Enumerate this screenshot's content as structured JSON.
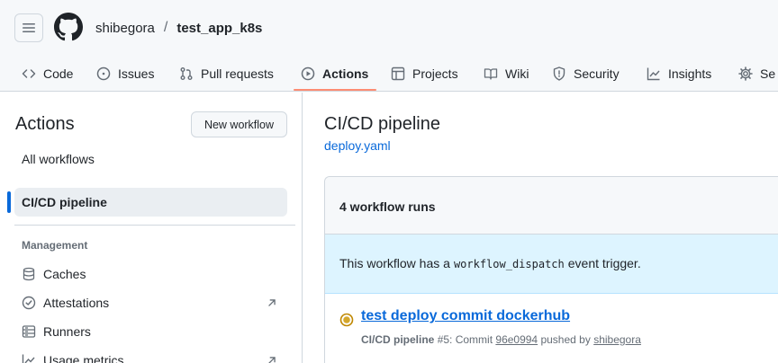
{
  "header": {
    "owner": "shibegora",
    "separator": "/",
    "repo": "test_app_k8s",
    "menu_icon": "hamburger-icon",
    "logo_icon": "github-mark-icon"
  },
  "tabs": [
    {
      "label": "Code",
      "icon": "code-icon"
    },
    {
      "label": "Issues",
      "icon": "issue-opened-icon"
    },
    {
      "label": "Pull requests",
      "icon": "git-pull-request-icon"
    },
    {
      "label": "Actions",
      "icon": "play-icon",
      "active": true
    },
    {
      "label": "Projects",
      "icon": "table-icon"
    },
    {
      "label": "Wiki",
      "icon": "book-icon"
    },
    {
      "label": "Security",
      "icon": "shield-icon"
    },
    {
      "label": "Insights",
      "icon": "graph-icon"
    },
    {
      "label": "Se",
      "icon": "gear-icon"
    }
  ],
  "sidebar": {
    "title": "Actions",
    "new_workflow_label": "New workflow",
    "all_workflows_label": "All workflows",
    "selected_workflow_label": "CI/CD pipeline",
    "management_heading": "Management",
    "management_items": [
      {
        "label": "Caches",
        "icon": "database-icon",
        "external": false
      },
      {
        "label": "Attestations",
        "icon": "verified-icon",
        "external": true
      },
      {
        "label": "Runners",
        "icon": "server-icon",
        "external": false
      },
      {
        "label": "Usage metrics",
        "icon": "graph-icon",
        "external": true
      }
    ]
  },
  "main": {
    "workflow_title": "CI/CD pipeline",
    "workflow_file": "deploy.yaml",
    "runs_count": "4 workflow runs",
    "dispatch_prefix": "This workflow has a",
    "dispatch_code": "workflow_dispatch",
    "dispatch_suffix": "event trigger.",
    "run": {
      "title": "test deploy commit dockerhub",
      "workflow_name": "CI/CD pipeline",
      "run_number": "#5: Commit",
      "commit_sha": "96e0994",
      "pushed_by_text": "pushed by",
      "actor": "shibegora",
      "status_icon": "in-progress-dot-icon",
      "status_color": "#bf8700"
    }
  },
  "colors": {
    "accent_link": "#0969da",
    "tab_underline": "#fd8c73",
    "info_banner": "#ddf4ff"
  }
}
